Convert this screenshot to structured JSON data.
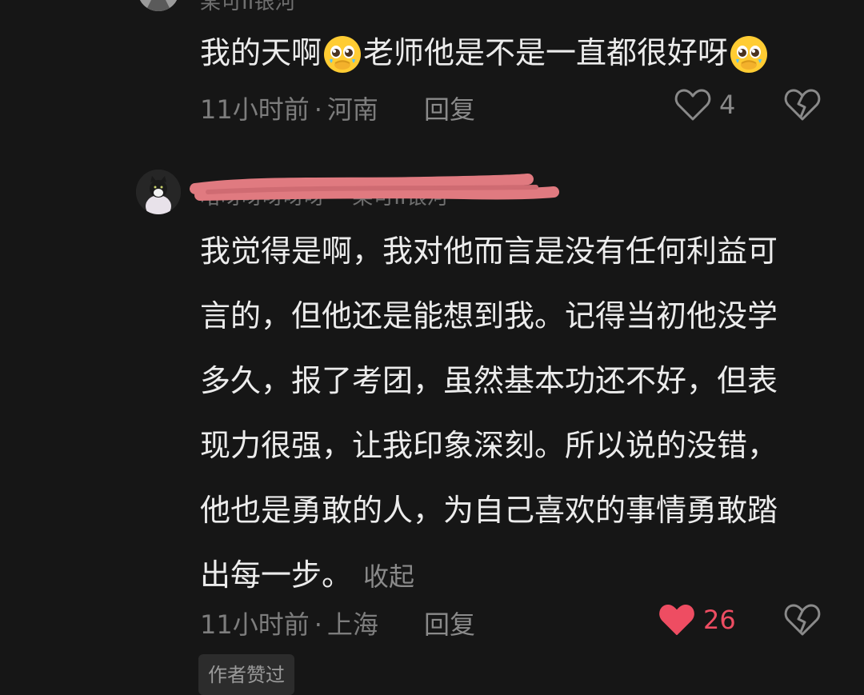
{
  "comment1": {
    "username": "某可II银河",
    "text_parts": [
      "我的天啊",
      "老师他是不是一直都很好呀"
    ],
    "time": "11小时前",
    "location": "河南",
    "reply_label": "回复",
    "like_count": "4",
    "liked": false
  },
  "comment2": {
    "username": "哈呀呀呀呀呀 一某可II银河",
    "text_lines": [
      "我觉得是啊，我对他而言是没有任何利益可",
      "言的，但他还是能想到我。记得当初他没学",
      "多久，报了考团，虽然基本功还不好，但表",
      "现力很强，让我印象深刻。所以说的没错，",
      "他也是勇敢的人，为自己喜欢的事情勇敢踏",
      "出每一步。"
    ],
    "collapse_label": "收起",
    "time": "11小时前",
    "location": "上海",
    "reply_label": "回复",
    "like_count": "26",
    "liked": true,
    "badge": "作者赞过"
  },
  "separator": "·",
  "icons": {
    "like": "heart-outline-icon",
    "liked": "heart-filled-icon",
    "dislike": "broken-heart-icon",
    "emoji": "pleading-face-emoji"
  },
  "colors": {
    "background": "#161616",
    "liked": "#ee4d62",
    "redaction": "#e07a80"
  }
}
